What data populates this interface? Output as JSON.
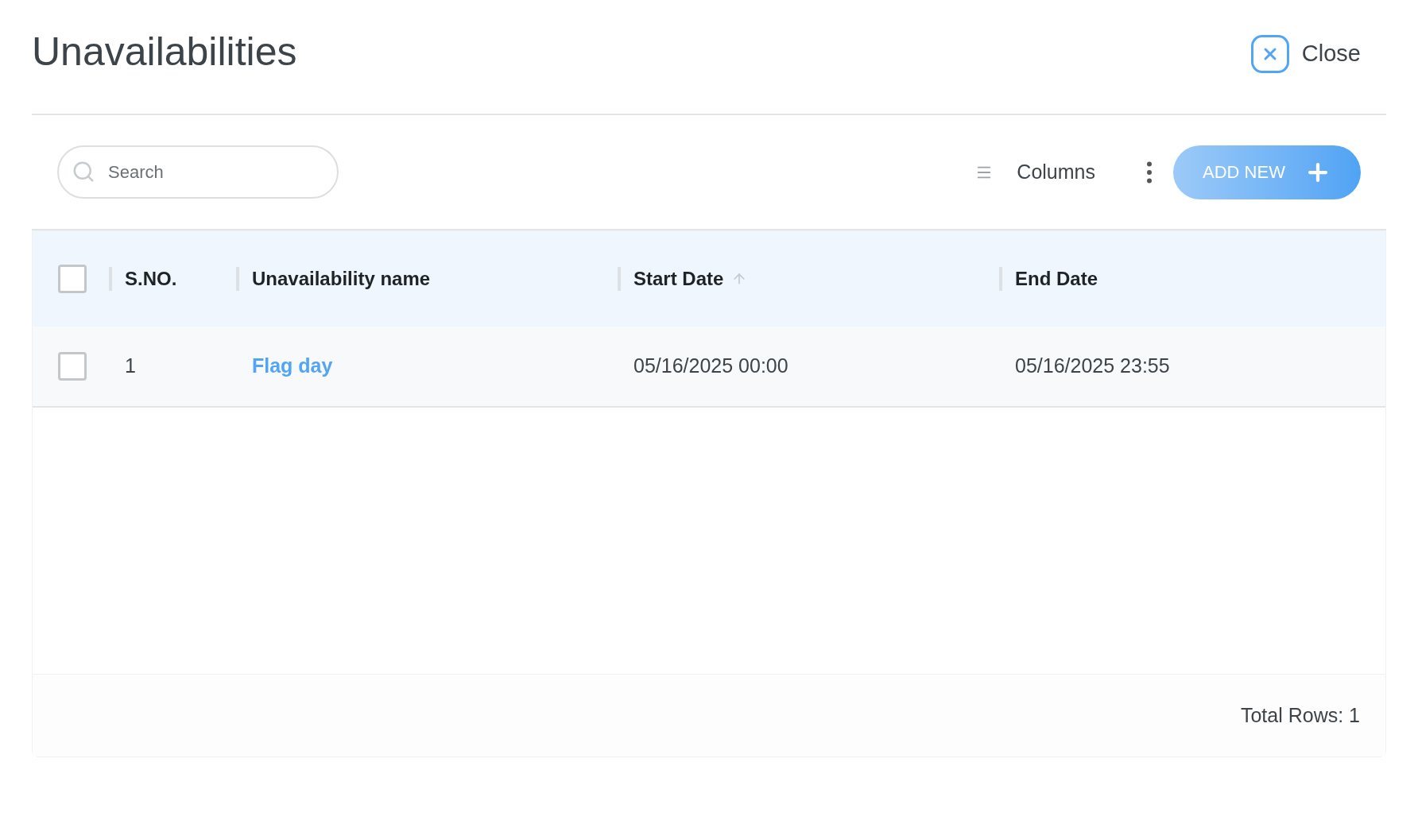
{
  "dialog": {
    "title": "Unavailabilities",
    "close_label": "Close"
  },
  "toolbar": {
    "search": {
      "placeholder": "Search"
    },
    "columns_label": "Columns",
    "add_label": "ADD NEW"
  },
  "table": {
    "select_all": {
      "checked": false
    },
    "columns": [
      {
        "label": "S.NO.",
        "sorted": false
      },
      {
        "label": "Unavailability name",
        "sorted": false
      },
      {
        "label": "Start Date",
        "sorted": true
      },
      {
        "label": "End Date",
        "sorted": false
      }
    ],
    "rows": [
      {
        "checked": false,
        "cells": [
          "1",
          "Flag day",
          "05/16/2025 00:00",
          "05/16/2025 23:55"
        ]
      }
    ]
  },
  "footer": {
    "total": "Total Rows: 1"
  }
}
